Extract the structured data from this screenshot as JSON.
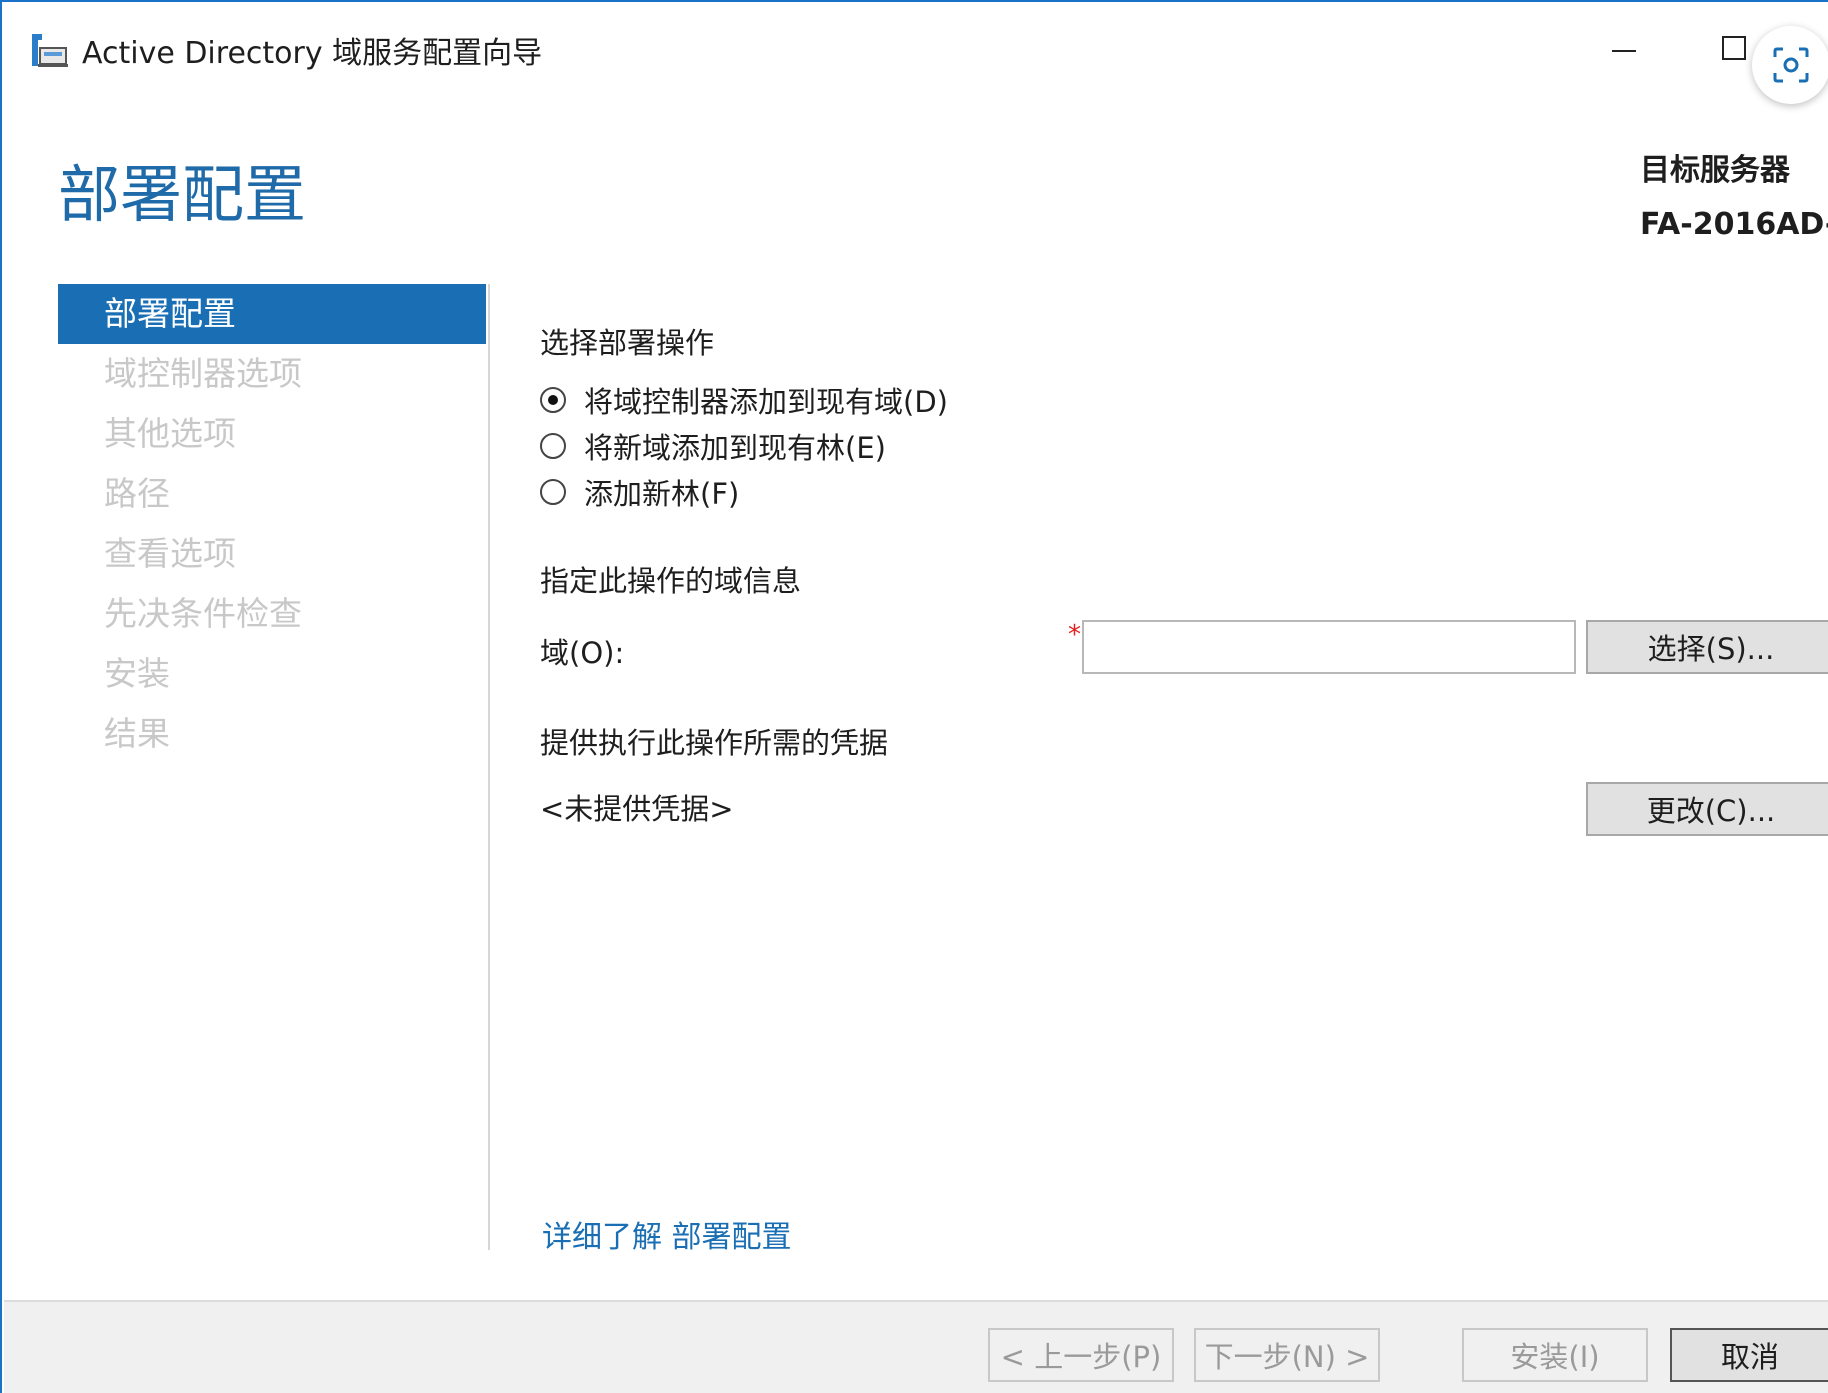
{
  "window": {
    "title": "Active Directory 域服务配置向导"
  },
  "header": {
    "page_title": "部署配置",
    "target_server_label": "目标服务器",
    "target_server_name": "FA-2016AD-"
  },
  "nav": {
    "items": [
      {
        "label": "部署配置",
        "active": true
      },
      {
        "label": "域控制器选项",
        "active": false
      },
      {
        "label": "其他选项",
        "active": false
      },
      {
        "label": "路径",
        "active": false
      },
      {
        "label": "查看选项",
        "active": false
      },
      {
        "label": "先决条件检查",
        "active": false
      },
      {
        "label": "安装",
        "active": false
      },
      {
        "label": "结果",
        "active": false
      }
    ]
  },
  "main": {
    "select_operation_label": "选择部署操作",
    "radio_options": [
      {
        "label": "将域控制器添加到现有域(D)",
        "checked": true
      },
      {
        "label": "将新域添加到现有林(E)",
        "checked": false
      },
      {
        "label": "添加新林(F)",
        "checked": false
      }
    ],
    "domain_info_label": "指定此操作的域信息",
    "domain_field_label": "域(O):",
    "domain_value": "",
    "select_button": "选择(S)...",
    "credentials_label": "提供执行此操作所需的凭据",
    "credentials_value": "<未提供凭据>",
    "change_button": "更改(C)...",
    "learn_more_prefix": "详细了解",
    "learn_more_link": "部署配置"
  },
  "footer": {
    "prev_button": "< 上一步(P)",
    "next_button": "下一步(N) >",
    "install_button": "安装(I)",
    "cancel_button": "取消"
  },
  "colors": {
    "accent": "#1a6fb4",
    "title_blue": "#1f6aa8",
    "required": "#e02020"
  }
}
